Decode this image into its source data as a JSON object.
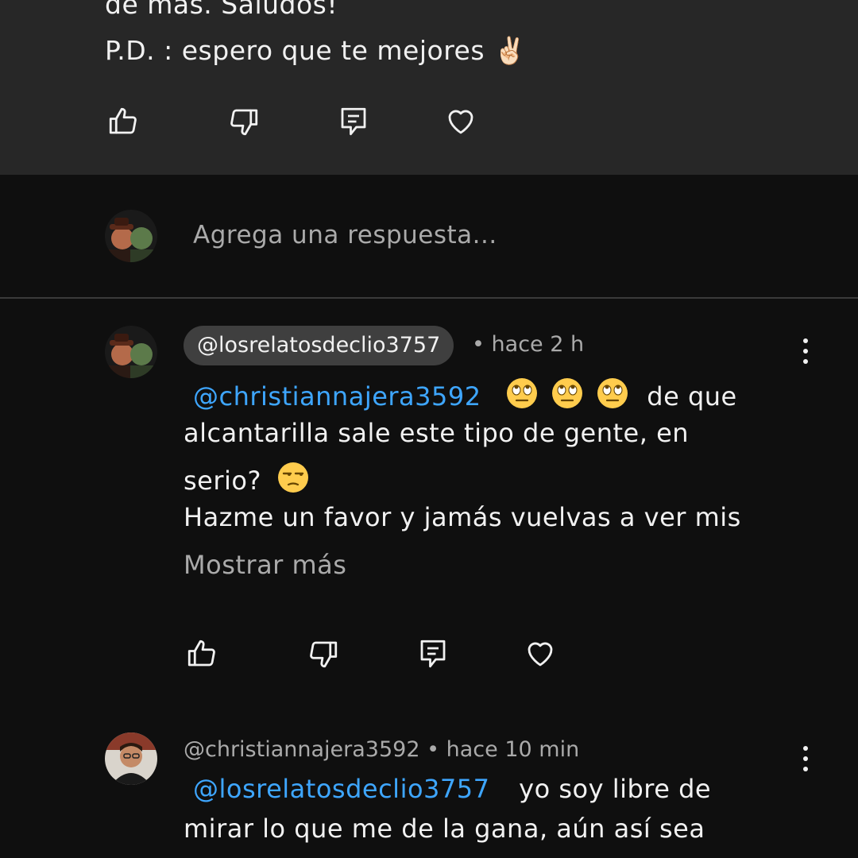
{
  "top_comment": {
    "line1": "de más. Saludos!",
    "line2": "P.D. : espero que te mejores ✌🏻",
    "actions": {
      "like": "like-icon",
      "dislike": "dislike-icon",
      "reply": "reply-icon",
      "heart": "heart-icon"
    }
  },
  "reply_box": {
    "placeholder": "Agrega una respuesta..."
  },
  "replies": [
    {
      "author": "@losrelatosdeclio3757",
      "separator": "•",
      "time": "hace 2 h",
      "mention": "@christiannajera3592",
      "line1_rest": "de que",
      "line2": "alcantarilla sale este tipo de gente, en",
      "line3": "serio?",
      "line4": "Hazme un favor y jamás vuelvas a ver mis",
      "show_more": "Mostrar más"
    },
    {
      "author": "@christiannajera3592",
      "separator": "•",
      "time": "hace 10 min",
      "mention": "@losrelatosdeclio3757",
      "line1_rest": "yo soy libre de",
      "line2": "mirar lo que me de la gana, aún así sea"
    }
  ],
  "colors": {
    "background": "#0f0f0f",
    "highlighted_comment": "#272727",
    "mention": "#3ea6ff",
    "secondary_text": "#aaaaaa",
    "handle_pill": "#3f3f3f"
  }
}
